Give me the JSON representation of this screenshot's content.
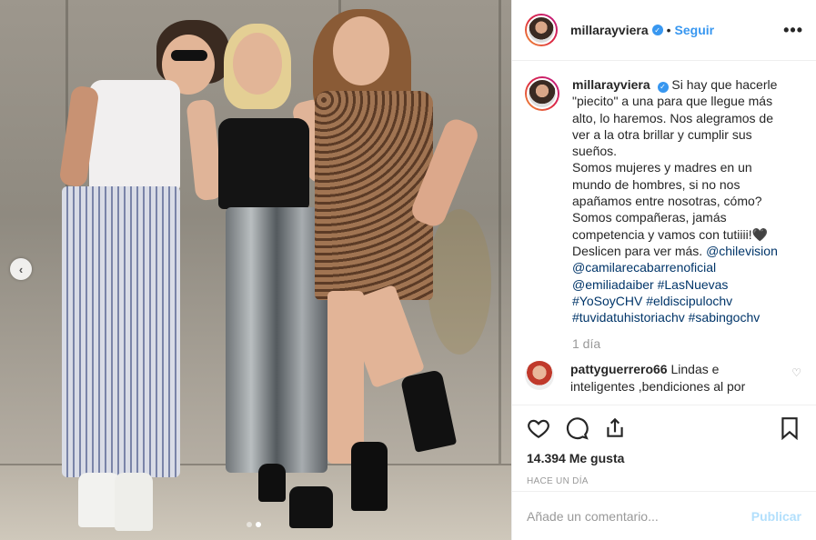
{
  "post": {
    "author": "millarayviera",
    "follow_label": "Seguir",
    "separator": "•",
    "more_label": "•••"
  },
  "photo": {
    "carousel_dots": 2,
    "active_dot": 1,
    "prev_icon": "chevron-left-icon"
  },
  "caption": {
    "author": "millarayviera",
    "text_lines": [
      "Si hay que hacerle",
      "\"piecito\" a una para que llegue más",
      "alto, lo haremos. Nos alegramos de",
      "ver a la otra brillar y cumplir sus",
      "sueños.",
      "Somos mujeres y madres en un",
      "mundo de hombres, si no nos",
      "apañamos entre nosotras, cómo?",
      "Somos compañeras, jamás",
      "competencia y vamos con tutiiii!🖤",
      "Deslicen para ver más."
    ],
    "mention_chv": "@chilevision",
    "mentions": [
      "@camilarecabarrenoficial",
      "@emiliadaiber"
    ],
    "hashtags_line1": "#LasNuevas",
    "hashtags_line2": [
      "#YoSoyCHV",
      "#eldiscipulochv"
    ],
    "hashtags_line3": [
      "#tuvidatuhistoriachv",
      "#sabingochv"
    ],
    "time": "1 día"
  },
  "comment": {
    "author": "pattyguerrero66",
    "text": "Lindas e inteligentes ,bendiciones al por"
  },
  "actions": {
    "icons": [
      "heart-icon",
      "comment-icon",
      "share-icon",
      "save-icon"
    ],
    "likes": "14.394 Me gusta",
    "date": "HACE UN DÍA"
  },
  "composer": {
    "placeholder": "Añade un comentario...",
    "publish_label": "Publicar"
  },
  "colors": {
    "accent": "#3897f0",
    "publish_disabled": "#b2dffc",
    "link": "#003569",
    "muted": "#999999"
  }
}
